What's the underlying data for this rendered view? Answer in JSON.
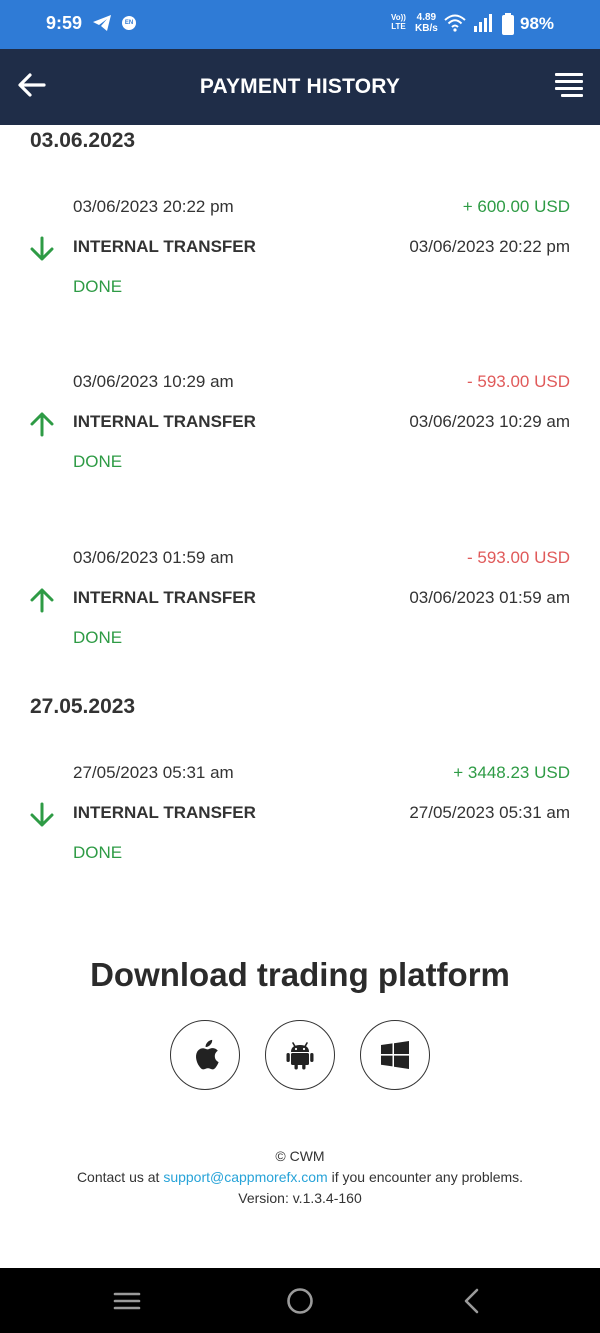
{
  "status_bar": {
    "time": "9:59",
    "volte_top": "Vo))",
    "volte_bottom": "LTE",
    "speed_value": "4.89",
    "speed_unit": "KB/s",
    "battery": "98%",
    "notif_badge": "EN"
  },
  "app_bar": {
    "title": "PAYMENT HISTORY",
    "back_icon": "arrow-left-icon",
    "menu_icon": "hamburger-menu-icon",
    "background": "#1f2d48"
  },
  "groups": [
    {
      "date": "03.06.2023",
      "transactions": [
        {
          "datetime": "03/06/2023 20:22 pm",
          "amount": "+ 600.00 USD",
          "direction": "in",
          "type": "INTERNAL TRANSFER",
          "datetime2": "03/06/2023 20:22 pm",
          "status": "DONE"
        },
        {
          "datetime": "03/06/2023 10:29 am",
          "amount": "- 593.00 USD",
          "direction": "out",
          "type": "INTERNAL TRANSFER",
          "datetime2": "03/06/2023 10:29 am",
          "status": "DONE"
        },
        {
          "datetime": "03/06/2023 01:59 am",
          "amount": "- 593.00 USD",
          "direction": "out",
          "type": "INTERNAL TRANSFER",
          "datetime2": "03/06/2023 01:59 am",
          "status": "DONE"
        }
      ]
    },
    {
      "date": "27.05.2023",
      "transactions": [
        {
          "datetime": "27/05/2023 05:31 am",
          "amount": "+ 3448.23 USD",
          "direction": "in",
          "type": "INTERNAL TRANSFER",
          "datetime2": "27/05/2023 05:31 am",
          "status": "DONE"
        }
      ]
    }
  ],
  "download": {
    "title": "Download trading platform",
    "platforms": [
      "apple-icon",
      "android-icon",
      "windows-icon"
    ]
  },
  "footer": {
    "copyright": "© CWM",
    "contact_prefix": "Contact us at",
    "email": "support@cappmorefx.com",
    "contact_suffix": "if you encounter any problems.",
    "version": "Version: v.1.3.4-160"
  },
  "colors": {
    "status_bar": "#2f7bd6",
    "positive": "#2e9b45",
    "negative": "#e05a5a",
    "link": "#27a3d8"
  }
}
